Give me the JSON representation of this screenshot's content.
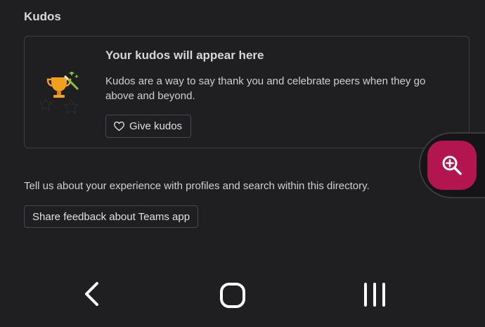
{
  "section": {
    "title": "Kudos"
  },
  "kudos_card": {
    "heading": "Your kudos will appear here",
    "description": "Kudos are a way to say thank you and celebrate peers when they go above and beyond.",
    "give_button_label": "Give kudos",
    "illustration_icon": "trophy-with-stars-icon"
  },
  "feedback": {
    "prompt": "Tell us about your experience with profiles and search within this directory.",
    "button_label": "Share feedback about Teams app"
  },
  "zoom_widget": {
    "icon": "zoom-in-icon",
    "accent_color": "#b3154f"
  },
  "nav_bar": {
    "back_icon": "back-chevron-icon",
    "home_icon": "home-icon",
    "recents_icon": "recent-apps-icon"
  },
  "colors": {
    "background": "#1f1f21",
    "trophy": "#f0a01e",
    "wand_star": "#7ec84a"
  }
}
